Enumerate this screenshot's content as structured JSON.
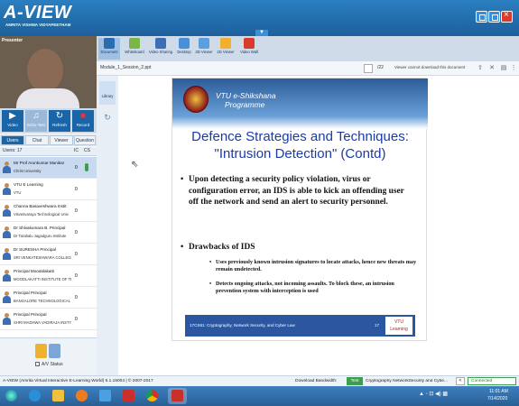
{
  "app": {
    "logo": "A-VIEW",
    "logo_sub": "AMRITA VISHWA VIDYAPEETHAM",
    "collapse_glyph": "▼"
  },
  "presenter": {
    "label": "Presenter"
  },
  "controls": {
    "video": "Video",
    "echo": "Echo Test",
    "refresh": "Refresh",
    "record": "Record"
  },
  "tabs": {
    "users": "Users",
    "chat": "Chat",
    "viewer": "Viewer",
    "question": "Question"
  },
  "users_panel": {
    "count_label": "Users: 17",
    "col_ic": "IC",
    "col_cs": "CS",
    "users": [
      {
        "name": "Mr Prof Arunkumar Manikar",
        "org": "Christ University",
        "ic": "0"
      },
      {
        "name": "VTU E Learning",
        "org": "VTU",
        "ic": "0"
      },
      {
        "name": "Channa Basaveshwara Instit",
        "org": "Visvesvaraya Technological Univ",
        "ic": "0"
      },
      {
        "name": "Dr Shivakumara B. Principal",
        "org": "Dr Tarabalu Jagadguru Institute",
        "ic": "0"
      },
      {
        "name": "Dr SURESHA Principal",
        "org": "SRI VENKATESHWARA COLLEGE",
        "ic": "0"
      },
      {
        "name": "Principal Moodalakatti",
        "org": "MOODLAKATTI INSTITUTE OF TE",
        "ic": "0"
      },
      {
        "name": "Principal Principal",
        "org": "BANGALORE TECHNOLOGICAL I",
        "ic": "0"
      },
      {
        "name": "Principal Principal",
        "org": "SHRI MADHWA VADIRAJA INSTITUTE",
        "ic": "0"
      }
    ],
    "av_status": "A/V Status"
  },
  "doc_toolbar": {
    "document": "Document",
    "whiteboard": "Whiteboard",
    "video_sharing": "Video Sharing",
    "desktop": "Desktop",
    "view3d": "3D Viewer",
    "view2d": "2D Viewer",
    "video_wall": "Video Wall"
  },
  "doc_bar": {
    "file_name": "Module_1_Session_2.ppt",
    "page_indicator": "/22",
    "download_note": "Viewer cannot download this document"
  },
  "library": {
    "label": "Library"
  },
  "slide": {
    "programme_line1": "VTU e-Shikshana",
    "programme_line2": "Programme",
    "title_line1": "Defence Strategies and Techniques:",
    "title_line2": "\"Intrusion Detection\" (Contd)",
    "bullet1": "Upon detecting a security policy violation, virus or configuration error, an IDS is able to kick an offending user off the network and send an alert to security personnel.",
    "bullet2": "Drawbacks of IDS",
    "sub1": "Uses previously known intrusion signatures to locate attacks, hence new threats may remain undetected.",
    "sub2": "Detects ongoing attacks, not incoming assaults. To block these, an intrusion prevention system with interception is used",
    "footer_text": "17CS61: Cryptography, Network Security, and Cyber Law",
    "footer_num": "17",
    "footer_logo_line1": "VTU",
    "footer_logo_line2": "Learning"
  },
  "status_bar": {
    "left": "A-VIEW (Amrita Virtual Interactive E-Learning World) 6.1.15004 | © 2007-2017",
    "bandwidth_label": "Download Bandwidth:",
    "bandwidth_btn": "Test",
    "file": "Cryptography NetworkSecurity and Cybe...",
    "nav": "<",
    "connected": "Connected"
  },
  "taskbar": {
    "tray_glyphs": "▲ ◦ ⊡ ◀) ▩",
    "time": "11:01 AM",
    "date": "7/14/2020"
  },
  "colors": {
    "brand_blue": "#1a64a8",
    "title_blue": "#1a3aa8",
    "ok_green": "#3aa04a"
  }
}
